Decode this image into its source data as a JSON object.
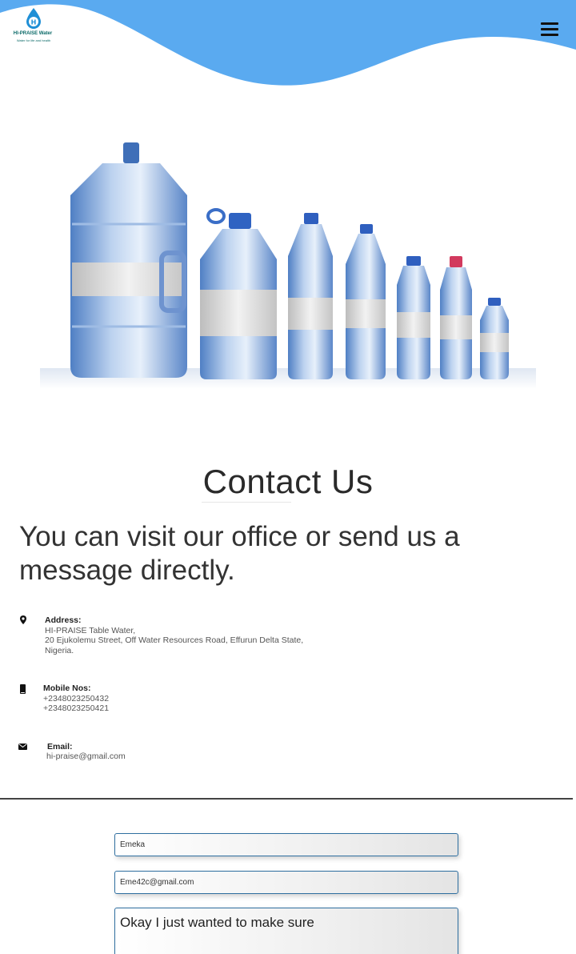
{
  "header": {
    "logo_name": "HI-PRAISE Water",
    "logo_tagline": "Water for life and health",
    "brand_color": "#5aaaf0",
    "icons": {
      "logo": "water-drop-logo-icon",
      "menu": "hamburger-menu-icon"
    }
  },
  "hero": {
    "image": "water-bottles-lineup"
  },
  "contact": {
    "title": "Contact Us",
    "subtitle": "You can visit our office or send us a message directly.",
    "address": {
      "label": "Address:",
      "line1": "HI-PRAISE Table Water,",
      "line2": "20 Ejukolemu Street, Off Water Resources Road, Effurun Delta State,",
      "line3": "Nigeria.",
      "icon": "map-pin-icon"
    },
    "mobile": {
      "label": "Mobile Nos:",
      "line1": "+2348023250432",
      "line2": "+2348023250421",
      "icon": "mobile-phone-icon"
    },
    "email": {
      "label": "Email:",
      "value": "hi-praise@gmail.com",
      "icon": "envelope-icon"
    }
  },
  "form": {
    "name_value": "Emeka",
    "email_value": "Eme42c@gmail.com",
    "message_value": "Okay I just wanted to make sure"
  }
}
